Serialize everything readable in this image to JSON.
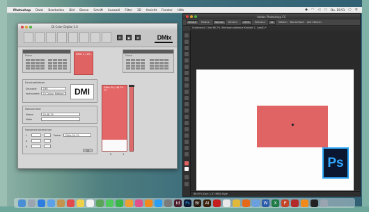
{
  "menubar": {
    "app": "Photoshop",
    "items": [
      "Datei",
      "Bearbeiten",
      "Bild",
      "Ebene",
      "Schrift",
      "Auswahl",
      "Filter",
      "3D",
      "Ansicht",
      "Fenster",
      "Hilfe"
    ],
    "time": "Do. 19:51"
  },
  "dmi_window": {
    "title": "DI Color Digital 3.0",
    "logo_dmix": "DMix",
    "logo_dmi": "DMI",
    "panel_left_title": "Farbe",
    "panel_right_title": "Farbe",
    "swatch_top_label": "DMix 1 / 29...",
    "section_profile": "Druckverfahren",
    "label_druckart": "Druckart",
    "druckart_value": "DMI",
    "label_instrument": "Instrument",
    "instrument_value": "DI Colour Method 2.0",
    "section_name": "Farbnummer",
    "label_name": "Name",
    "name_value": "DI-48-79",
    "label_notiz": "Notiz",
    "section_values": "Farbwerte berechnen",
    "label_l": "L",
    "label_a": "a",
    "label_b": "b",
    "label_farbe": "Farbe",
    "farbe_value": "DMix-29-79",
    "ok_label": "OK",
    "big_swatch_label": "DMix 29 / 48 79 79",
    "scale_0": "0",
    "scale_1": "1"
  },
  "photoshop": {
    "window_title": "Adobe Photoshop CC",
    "options": [
      "Verlauf",
      "Modus:",
      "Normal",
      "Deckkr.:",
      "100%",
      "Toleranz:",
      "32",
      "Glätten",
      "Benachbart",
      "Alle Ebenen"
    ],
    "doc_tab": "Unbenannt-1 bei 66,7% (Hintergrundebene Kontakt 1, Lab/8) *",
    "status": "66,67%   Dok: 1,37 MB/0 Byte",
    "logo_text": "Ps"
  },
  "dock": {
    "icons": [
      "finder-icon",
      "launchpad-icon",
      "safari-icon",
      "mail-icon",
      "contacts-icon",
      "calendar-icon",
      "notes-icon",
      "reminders-icon",
      "maps-icon",
      "messages-icon",
      "facetime-icon",
      "photos-icon",
      "itunes-icon",
      "ibooks-icon",
      "appstore-icon",
      "systemprefs-icon",
      "indesign-icon",
      "photoshop-icon",
      "bridge-icon",
      "illustrator-icon",
      "acrobat-icon",
      "textedit-icon",
      "chrome-icon",
      "firefox-icon",
      "preview-icon",
      "word-icon",
      "excel-icon",
      "powerpoint-icon",
      "filezilla-icon",
      "vlc-icon",
      "terminal-icon",
      "trash-icon"
    ],
    "labels": [
      "",
      "",
      "",
      "",
      "",
      "",
      "",
      "",
      "",
      "",
      "",
      "",
      "",
      "",
      "",
      "",
      "Id",
      "Ps",
      "Br",
      "Ai",
      "",
      "",
      "",
      "",
      "",
      "W",
      "X",
      "P",
      "",
      "",
      "",
      ""
    ],
    "colors": [
      "#4a8fd6",
      "#9aa5b1",
      "#2d7de0",
      "#5ba0e8",
      "#c2944e",
      "#e24b4b",
      "#f0d24a",
      "#f2f2f2",
      "#5aa55a",
      "#4fc95a",
      "#3ab54a",
      "#f0a030",
      "#e0508c",
      "#f28b1e",
      "#2a9df4",
      "#7b7b7b",
      "#4a1c2c",
      "#0b1730",
      "#2b1b0f",
      "#3a1f0a",
      "#c41e1e",
      "#e8e8e8",
      "#e0b83a",
      "#e46a1a",
      "#6aa0e0",
      "#2b5aa8",
      "#1e7a45",
      "#c4462a",
      "#b22a2a",
      "#f08a1a",
      "#222222",
      "#9aa5b1"
    ]
  }
}
